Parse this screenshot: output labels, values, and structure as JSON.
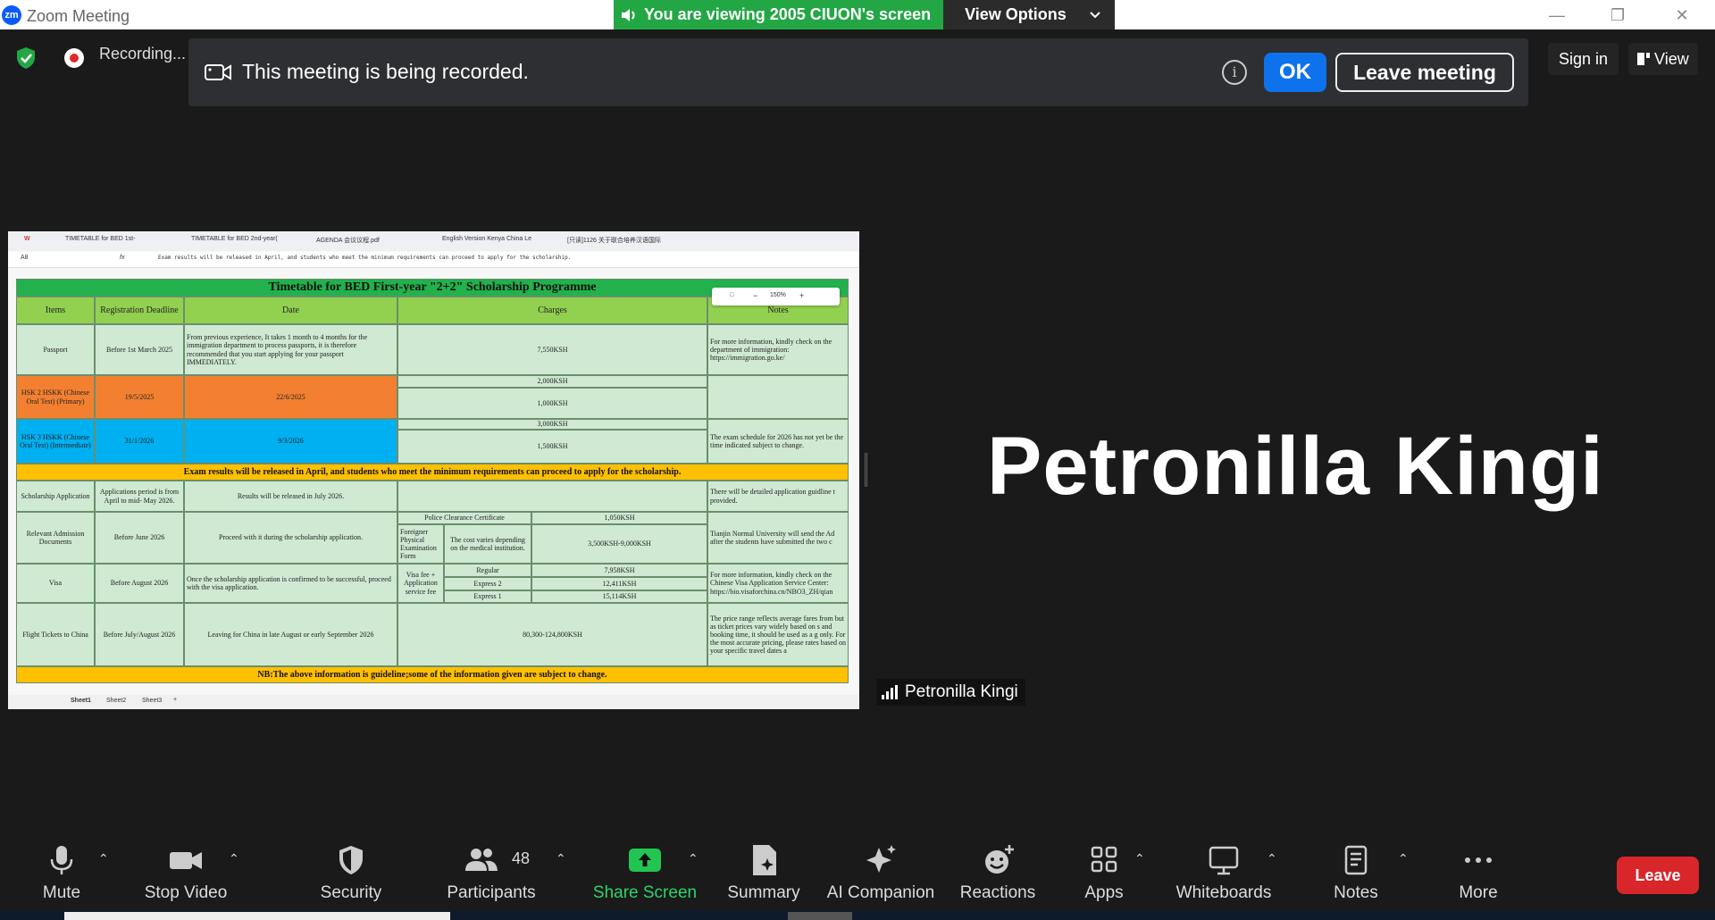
{
  "window": {
    "app_title": "Zoom Meeting",
    "logo": "zm"
  },
  "view_banner": {
    "text": "You are viewing 2005 CIUON's screen",
    "options_label": "View Options"
  },
  "topbar": {
    "recording_label": "Recording...",
    "sign_in": "Sign in",
    "view": "View"
  },
  "record_notice": {
    "message": "This meeting is being recorded.",
    "ok": "OK",
    "leave": "Leave meeting"
  },
  "shared_screen": {
    "tabs": [
      "TIMETABLE for BED 1st-",
      "TIMETABLE for BED 2nd-year(",
      "AGENDA 会议议程.pdf",
      "English Version Kenya China Le",
      "[只读]1126 关于联合培养汉语国际"
    ],
    "cell_ref": "A8",
    "formula": "Exam results will be released in April, and students who meet the minimum requirements can proceed to apply for the scholarship.",
    "zoom_level": "150%",
    "title": "Timetable for BED First-year \"2+2\" Scholarship Programme",
    "headers": [
      "Items",
      "Registration Deadline",
      "Date",
      "Charges",
      "Notes"
    ],
    "passport": {
      "item": "Passport",
      "deadline": "Before 1st March 2025",
      "date": "From previous experience, It takes 1 month to 4 months for the immigration department to process passports, it is therefore recommended that you start applying for your passport IMMEDIATELY.",
      "charge": "7,550KSH",
      "note": "For more information, kindly check on the department of immigration: https://immigration.go.ke/"
    },
    "hsk2": {
      "item": "HSK 2 HSKK (Chinese Oral Test) (Primary)",
      "deadline": "19/5/2025",
      "date": "22/6/2025",
      "charge1": "2,000KSH",
      "charge2": "1,000KSH"
    },
    "hsk3": {
      "item": "HSK 3 HSKK (Chinese Oral Test) (Intermediate)",
      "deadline": "31/1/2026",
      "date": "9/3/2026",
      "charge1": "3,000KSH",
      "charge2": "1,500KSH",
      "note": "The exam schedule for 2026 has not yet be the time indicated subject to change."
    },
    "exam_banner": "Exam results will be released in April, and students who meet the minimum requirements can proceed to apply for the scholarship.",
    "scholarship": {
      "item": "Scholarship Application",
      "deadline": "Applications period is from April to mid- May 2026.",
      "date": "Results will be released in July 2026.",
      "note": "There will be detailed application guidline t provided."
    },
    "admission": {
      "item": "Relevant Admission Documents",
      "deadline": "Before June 2026",
      "date": "Proceed with it during the scholarship application.",
      "police": "Police Clearance Certificate",
      "police_fee": "1,050KSH",
      "foreign": "Foreigner Physical Examination Form",
      "foreign_desc": "The cost varies depending on the medical institution.",
      "foreign_fee": "3,500KSH-9,000KSH",
      "note": "Tianjin Normal University will send the Ad after the students have submitted the two c"
    },
    "visa": {
      "item": "Visa",
      "deadline": "Before August 2026",
      "date": "Once the scholarship application is confirmed to be successful, proceed with the visa application.",
      "fee_label": "Visa fee + Application service fee",
      "options": [
        {
          "name": "Regular",
          "fee": "7,958KSH"
        },
        {
          "name": "Express 2",
          "fee": "12,411KSH"
        },
        {
          "name": "Express 1",
          "fee": "15,114KSH"
        }
      ],
      "note": "For more information, kindly check on the Chinese Visa Application Service Center: https://bio.visaforchina.cn/NBO3_ZH/qian"
    },
    "flight": {
      "item": "Flight Tickets to China",
      "deadline": "Before July/August 2026",
      "date": "Leaving for China in late August or early September 2026",
      "charge": "80,300-124,800KSH",
      "note": "The price range reflects average fares from but as ticket prices vary widely based on s and booking time, it should be used as a g only. For the most accurate pricing, please rates based on your specific travel dates a"
    },
    "footer": "NB:The above information is guideline;some of the information given are subject to change.",
    "sheets": [
      "Sheet1",
      "Sheet2",
      "Sheet3"
    ]
  },
  "participant": {
    "name": "Petronilla Kingi",
    "tag_name": "Petronilla Kingi"
  },
  "toolbar": {
    "mute": "Mute",
    "stop_video": "Stop Video",
    "security": "Security",
    "participants": "Participants",
    "participants_count": "48",
    "share_screen": "Share Screen",
    "summary": "Summary",
    "ai_companion": "AI Companion",
    "reactions": "Reactions",
    "apps": "Apps",
    "whiteboards": "Whiteboards",
    "notes": "Notes",
    "more": "More",
    "leave": "Leave"
  },
  "colors": {
    "share_green": "#23a745",
    "ok_blue": "#0e72ed",
    "leave_red": "#d9262b",
    "toolbar_bg": "#1a1a1a"
  }
}
